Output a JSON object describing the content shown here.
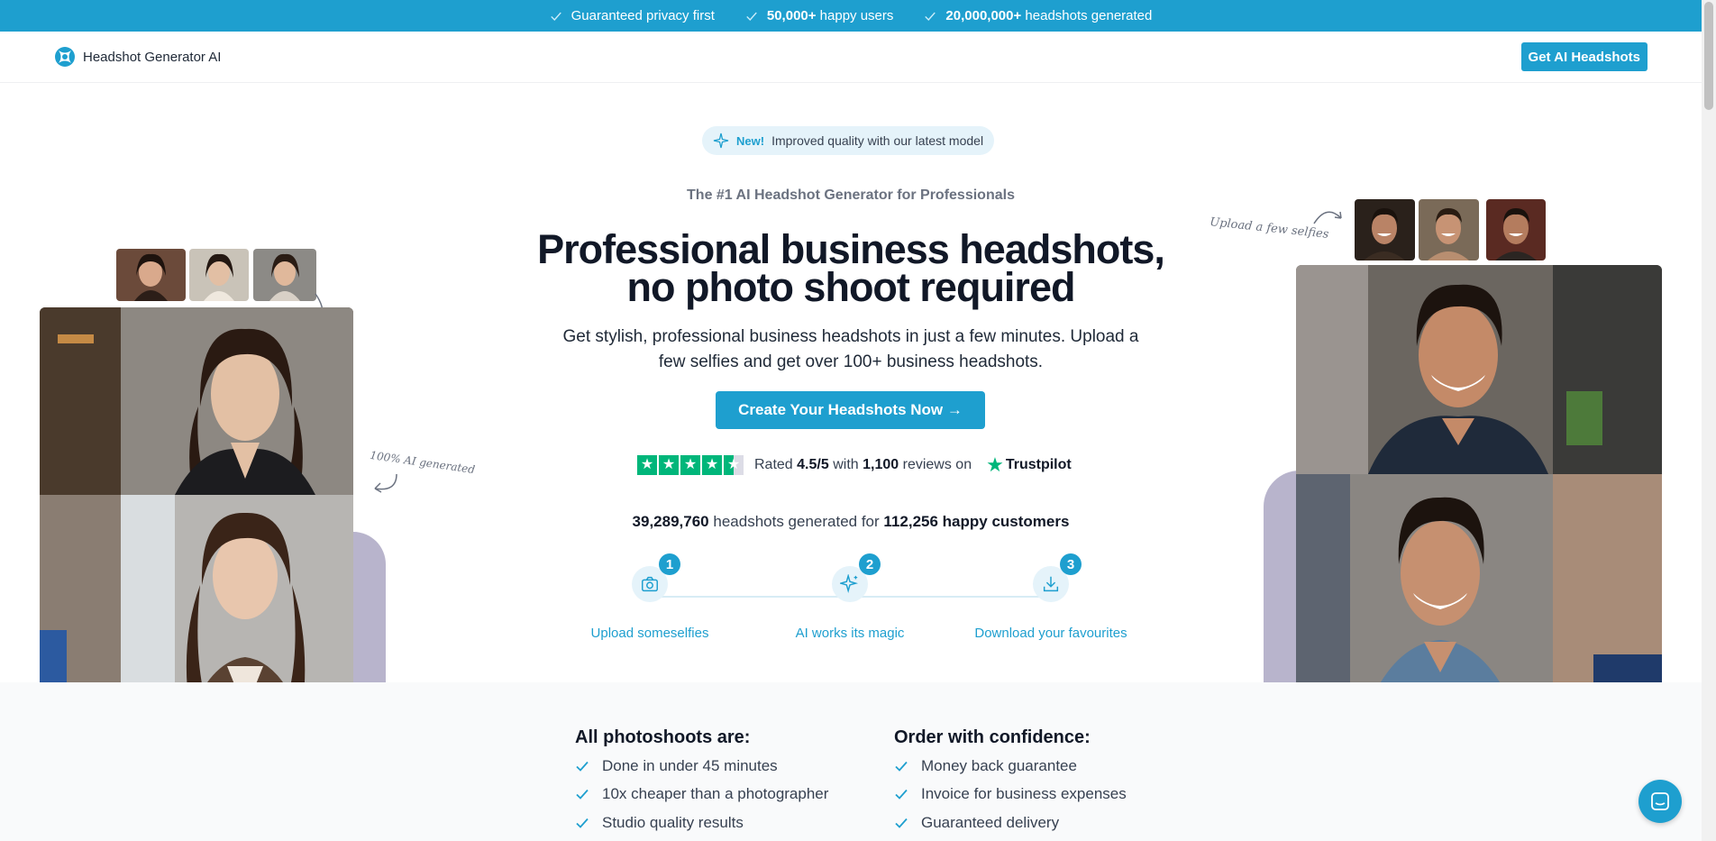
{
  "topbar": {
    "items": [
      {
        "bold": "",
        "text": "Guaranteed privacy first"
      },
      {
        "bold": "50,000+",
        "text": " happy users"
      },
      {
        "bold": "20,000,000+",
        "text": " headshots generated"
      }
    ]
  },
  "nav": {
    "brand": "Headshot Generator AI",
    "cta": "Get AI Headshots"
  },
  "hero": {
    "badge_new": "New!",
    "badge_text": "Improved quality with our latest model",
    "eyebrow": "The #1 AI Headshot Generator for Professionals",
    "headline_line1": "Professional business headshots,",
    "headline_line2": "no photo shoot required",
    "subtitle": "Get stylish, professional business headshots in just a few minutes. Upload a few selfies and get over 100+ business headshots.",
    "cta": "Create Your Headshots Now →",
    "rating": {
      "stars": 4.5,
      "prefix": "Rated",
      "score": "4.5/5",
      "with": "with",
      "count": "1,100",
      "suffix": "reviews on",
      "platform": "Trustpilot"
    },
    "stats": {
      "headshots": "39,289,760",
      "middle": "headshots generated for",
      "customers": "112,256 happy customers"
    },
    "steps": [
      {
        "num": "1",
        "label": "Upload someselfies",
        "icon": "camera-icon"
      },
      {
        "num": "2",
        "label": "AI works its magic",
        "icon": "sparkle-icon"
      },
      {
        "num": "3",
        "label": "Download your favourites",
        "icon": "download-icon"
      }
    ],
    "annotations": {
      "left": "100% AI generated",
      "right": "Upload a few selfies"
    }
  },
  "features": {
    "col1": {
      "title": "All photoshoots are:",
      "items": [
        "Done in under 45 minutes",
        "10x cheaper than a photographer",
        "Studio quality results"
      ]
    },
    "col2": {
      "title": "Order with confidence:",
      "items": [
        "Money back guarantee",
        "Invoice for business expenses",
        "Guaranteed delivery"
      ]
    }
  },
  "colors": {
    "accent": "#1e9fcf",
    "trustpilot": "#00b67a",
    "lavender": "#b8b4cc"
  }
}
